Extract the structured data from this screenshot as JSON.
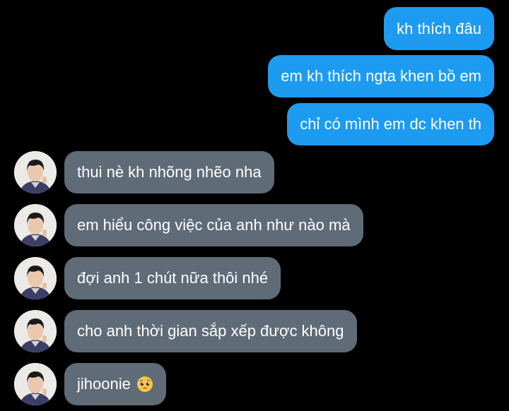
{
  "conversation": {
    "sent_messages": [
      {
        "text": "kh thích đâu"
      },
      {
        "text": "em kh thích ngta khen bồ em"
      },
      {
        "text": "chỉ có mình em dc khen th"
      }
    ],
    "received_messages": [
      {
        "text": "thui nè kh nhõng nhẽo nha"
      },
      {
        "text": "em hiểu công việc của anh như nào mà"
      },
      {
        "text": "đợi anh 1 chút nữa thôi nhé"
      },
      {
        "text": "cho anh thời gian sắp xếp được không"
      },
      {
        "text": "jihoonie",
        "emoji": "pleading-face-emoji"
      }
    ],
    "colors": {
      "background": "#000000",
      "sent_bubble": "#1d9bf0",
      "received_bubble": "#5f6b77",
      "text": "#ffffff"
    }
  }
}
